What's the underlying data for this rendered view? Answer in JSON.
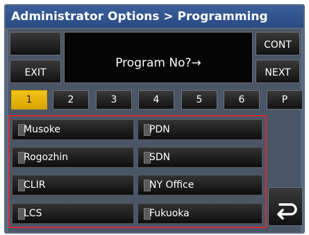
{
  "title": "Administrator Options > Programming",
  "display": {
    "prompt": "Program No?→"
  },
  "buttons": {
    "blank": "",
    "exit": "EXIT",
    "cont": "CONT",
    "next": "NEXT"
  },
  "number_keys": [
    "1",
    "2",
    "3",
    "4",
    "5",
    "6",
    "P"
  ],
  "active_number": "1",
  "list_items": [
    {
      "label": "Musoke"
    },
    {
      "label": "PDN"
    },
    {
      "label": "Rogozhin"
    },
    {
      "label": "SDN"
    },
    {
      "label": "CLIR"
    },
    {
      "label": "NY Office"
    },
    {
      "label": "LCS"
    },
    {
      "label": "Fukuoka"
    }
  ],
  "icons": {
    "back": "return-arrow-icon"
  },
  "colors": {
    "title_bar": "#2a4a82",
    "active_key": "#f3c417",
    "highlight_border": "#cf2f36"
  }
}
